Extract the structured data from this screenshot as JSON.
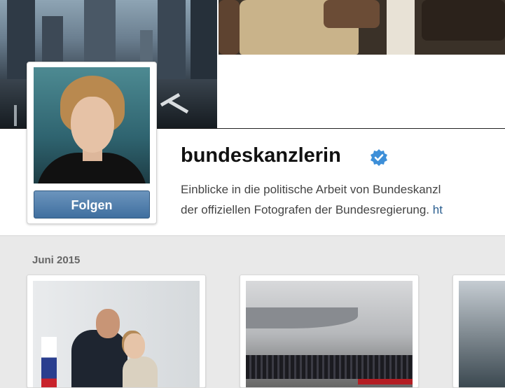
{
  "profile": {
    "username": "bundeskanzlerin",
    "verified": true,
    "follow_label": "Folgen",
    "bio_line1": "Einblicke in die politische Arbeit von Bundeskanzl",
    "bio_line2": "der offiziellen Fotografen der Bundesregierung.",
    "bio_link_fragment": "ht"
  },
  "feed": {
    "month_label": "Juni 2015"
  },
  "colors": {
    "follow_button": "#4a79a8",
    "verified_badge": "#3d8fd8",
    "link": "#2a5e8f"
  }
}
